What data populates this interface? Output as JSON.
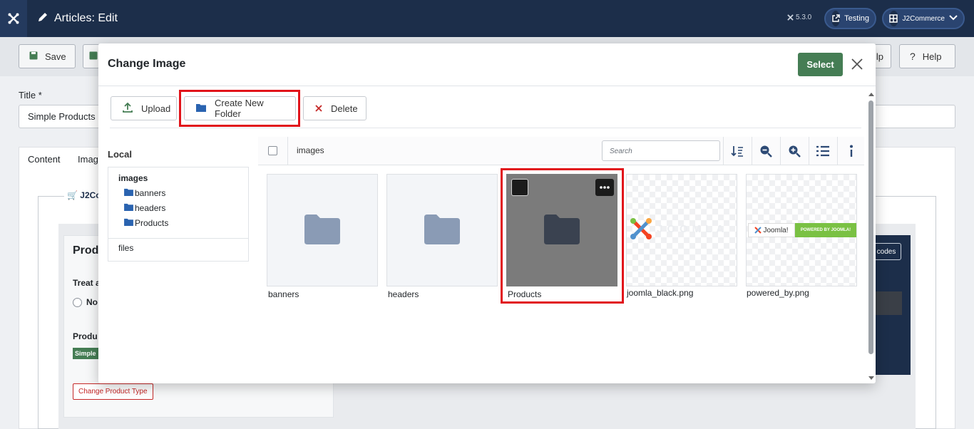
{
  "header": {
    "page_title": "Articles: Edit",
    "version": "5.3.0",
    "testing_label": "Testing",
    "user_label": "J2Commerce"
  },
  "background": {
    "toolbar": {
      "save_label": "Save",
      "help_label_partial": "lp",
      "help_label": "Help"
    },
    "title_label": "Title *",
    "title_value": "Simple Products",
    "tabs": {
      "content": "Content",
      "images_partial": "Imag"
    },
    "legend_partial": "J2Co",
    "card_heading_partial": "Prod",
    "treat_partial": "Treat a",
    "radio_label_partial": "No",
    "product_type_partial": "Produ",
    "badge_partial": "Simple",
    "change_type_button": "Change Product Type",
    "codes_button_partial": "codes"
  },
  "modal": {
    "title": "Change Image",
    "select_label": "Select",
    "toolbar": {
      "upload_label": "Upload",
      "create_folder_label": "Create New Folder",
      "delete_label": "Delete"
    },
    "sidebar": {
      "local_label": "Local",
      "root": "images",
      "folders": [
        "banners",
        "headers",
        "Products"
      ],
      "files_label": "files"
    },
    "browser": {
      "breadcrumb": "images",
      "search_placeholder": "Search",
      "items": [
        {
          "name": "banners",
          "kind": "folder"
        },
        {
          "name": "headers",
          "kind": "folder"
        },
        {
          "name": "Products",
          "kind": "folder",
          "selected": true
        },
        {
          "name": "joomla_black.png",
          "kind": "image"
        },
        {
          "name": "powered_by.png",
          "kind": "image"
        }
      ],
      "joomla_logo_text": "Joomla!",
      "powered_text": "POWERED BY JOOMLA!"
    }
  },
  "colors": {
    "header_bg": "#1c2e4a",
    "select_button": "#457d54",
    "highlight": "#e1141b",
    "folder_icon": "#8a9bb5"
  }
}
